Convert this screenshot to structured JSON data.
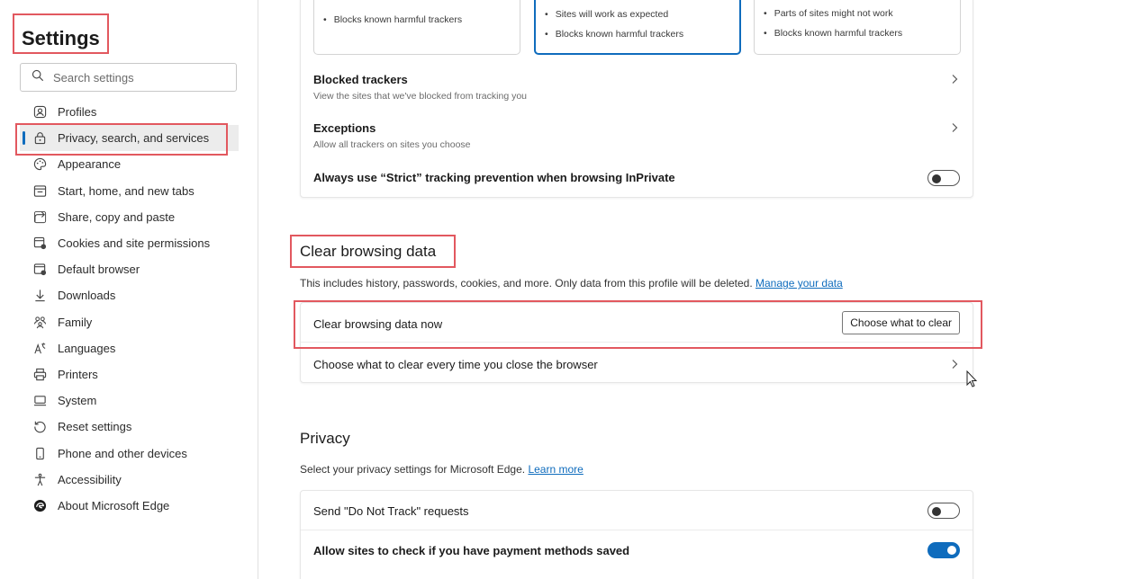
{
  "sidebar": {
    "title": "Settings",
    "search_placeholder": "Search settings",
    "items": [
      {
        "label": "Profiles",
        "icon": "profile-icon"
      },
      {
        "label": "Privacy, search, and services",
        "icon": "lock-icon",
        "active": true
      },
      {
        "label": "Appearance",
        "icon": "palette-icon"
      },
      {
        "label": "Start, home, and new tabs",
        "icon": "home-tab-icon"
      },
      {
        "label": "Share, copy and paste",
        "icon": "share-icon"
      },
      {
        "label": "Cookies and site permissions",
        "icon": "cookies-icon"
      },
      {
        "label": "Default browser",
        "icon": "browser-icon"
      },
      {
        "label": "Downloads",
        "icon": "download-icon"
      },
      {
        "label": "Family",
        "icon": "family-icon"
      },
      {
        "label": "Languages",
        "icon": "languages-icon"
      },
      {
        "label": "Printers",
        "icon": "printer-icon"
      },
      {
        "label": "System",
        "icon": "system-icon"
      },
      {
        "label": "Reset settings",
        "icon": "reset-icon"
      },
      {
        "label": "Phone and other devices",
        "icon": "phone-icon"
      },
      {
        "label": "Accessibility",
        "icon": "accessibility-icon"
      },
      {
        "label": "About Microsoft Edge",
        "icon": "edge-logo-icon"
      }
    ]
  },
  "tracking": {
    "choices": [
      {
        "bullets": [
          "Blocks known harmful trackers"
        ]
      },
      {
        "bullets": [
          "Sites will work as expected",
          "Blocks known harmful trackers"
        ],
        "selected": true
      },
      {
        "bullets": [
          "Parts of sites might not work",
          "Blocks known harmful trackers"
        ]
      }
    ],
    "blocked_title": "Blocked trackers",
    "blocked_sub": "View the sites that we've blocked from tracking you",
    "exceptions_title": "Exceptions",
    "exceptions_sub": "Allow all trackers on sites you choose",
    "strict_label": "Always use “Strict” tracking prevention when browsing InPrivate",
    "strict_on": false
  },
  "clear": {
    "heading": "Clear browsing data",
    "desc": "This includes history, passwords, cookies, and more. Only data from this profile will be deleted.",
    "link": "Manage your data",
    "now_label": "Clear browsing data now",
    "button": "Choose what to clear",
    "every_time_label": "Choose what to clear every time you close the browser"
  },
  "privacy": {
    "heading": "Privacy",
    "desc": "Select your privacy settings for Microsoft Edge.",
    "link": "Learn more",
    "dnt_label": "Send \"Do Not Track\" requests",
    "dnt_on": false,
    "payment_label": "Allow sites to check if you have payment methods saved",
    "payment_on": true
  },
  "colors": {
    "accent": "#0f6cbd",
    "highlight_box": "#e2585f"
  }
}
